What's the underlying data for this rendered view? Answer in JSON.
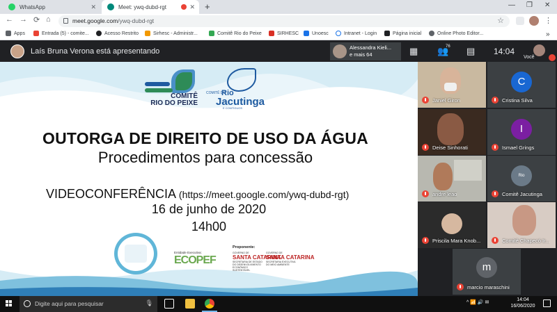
{
  "browser": {
    "tabs": [
      {
        "title": "WhatsApp",
        "active": false
      },
      {
        "title": "Meet: ywq-dubd-rgt",
        "active": true
      }
    ],
    "new_tab": "+",
    "window_controls": [
      "—",
      "❐",
      "✕"
    ],
    "url_host": "meet.google.com",
    "url_path": "/ywq-dubd-rgt",
    "bookmarks": [
      {
        "label": "Apps",
        "color": "#5f6368"
      },
      {
        "label": "Entrada (5) - comite...",
        "color": "#ea4335"
      },
      {
        "label": "Acesso Restrito",
        "color": "#202124"
      },
      {
        "label": "Sirhesc - Administr...",
        "color": "#f29900"
      },
      {
        "label": "Comitê Rio do Peixe",
        "color": "#34a853"
      },
      {
        "label": "SIRHESC",
        "color": "#d93025"
      },
      {
        "label": "Unoesc",
        "color": "#1a73e8"
      },
      {
        "label": "Intranet - Login",
        "color": "#1a73e8"
      },
      {
        "label": "Página inicial",
        "color": "#202124"
      },
      {
        "label": "Online Photo Editor...",
        "color": "#5f6368"
      }
    ]
  },
  "meet": {
    "presenter_text": "Laís Bruna Verona está apresentando",
    "pip_name": "Alessandra Kieli...",
    "pip_more": "e mais 64",
    "people_count": "76",
    "clock": "14:04",
    "self_label": "Você"
  },
  "slide": {
    "logo1_line1": "COMITÊ",
    "logo1_line2": "RIO DO PEIXE",
    "logo2_small": "COMITÊ DO",
    "logo2_big": "Rio",
    "logo2_big2": "Jacutinga",
    "logo2_tiny": "E CONTÍGUOS",
    "title": "OUTORGA DE DIREITO DE USO DA ÁGUA",
    "subtitle": "Procedimentos para concessão",
    "video_label": "VIDEOCONFERÊNCIA",
    "video_url": " (https://meet.google.com/ywq-dubd-rgt)",
    "date": "16 de junho de 2020",
    "time": "14h00",
    "ecopef_small": "Entidade Executiva:",
    "ecopef": "ECOPEF",
    "proponente": "Proponente:",
    "sc_top": "GOVERNO DE",
    "sc_name": "SANTA CATARINA",
    "sc1_sub": "SECRETARIA DE ESTADO DO DESENVOLVIMENTO ECONÔMICO SUSTENTÁVEL",
    "sc2_sub": "SECRETARIA EXECUTIVA DO MEIO AMBIENTE"
  },
  "participants": [
    {
      "name": "Janiel Giron",
      "type": "video",
      "bg": "#c9b9a0",
      "face": "#d8b49a"
    },
    {
      "name": "Cristina Silva",
      "type": "initial",
      "initial": "C",
      "color": "#1967d2"
    },
    {
      "name": "Deise Sinhorati",
      "type": "video",
      "bg": "#3a2a20",
      "face": "#8a5a44"
    },
    {
      "name": "Ismael Grings",
      "type": "initial",
      "initial": "I",
      "color": "#7b1fa2"
    },
    {
      "name": "andre leao",
      "type": "video",
      "bg": "#b8b8b0",
      "face": "#b07a5a"
    },
    {
      "name": "Comitê Jacutinga",
      "type": "logo",
      "color": "#6b7a88"
    },
    {
      "name": "Priscila Mara Knob...",
      "type": "photo",
      "bg": "#2b2b2b",
      "face": "#d6b8a0"
    },
    {
      "name": "Comitê Chapecó Ir...",
      "type": "video",
      "bg": "#d8ccc4",
      "face": "#c89884"
    },
    {
      "name": "marcio maraschini",
      "type": "initial",
      "initial": "m",
      "color": "#5f6368"
    }
  ],
  "taskbar": {
    "search_placeholder": "Digite aqui para pesquisar",
    "time": "14:04",
    "date": "16/06/2020",
    "tray": "^ 📶 🔊 ✉"
  }
}
